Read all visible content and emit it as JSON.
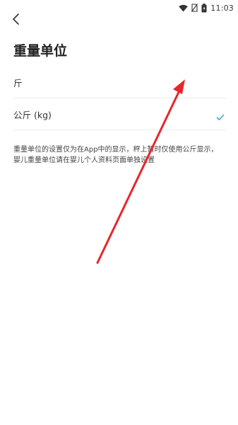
{
  "status_bar": {
    "time": "11:03",
    "icons": [
      "wifi-icon",
      "no-sim-icon",
      "battery-charging-icon"
    ]
  },
  "header": {
    "back_icon": "chevron-left-icon",
    "title": "重量单位"
  },
  "options": [
    {
      "label": "斤",
      "selected": false
    },
    {
      "label": "公斤 (kg)",
      "selected": true
    }
  ],
  "note": "重量单位的设置仅为在App中的显示，秤上暂时仅使用公斤显示，婴儿重量单位请在婴儿个人资料页面单独设置",
  "colors": {
    "accent": "#3ba8e0",
    "annotation_arrow": "#e8252a",
    "divider": "#ececec"
  }
}
